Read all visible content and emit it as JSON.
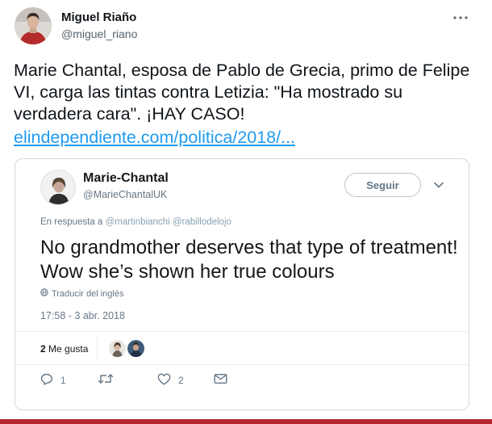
{
  "tweet": {
    "author": {
      "name": "Miguel Riaño",
      "handle": "@miguel_riano"
    },
    "text": "Marie Chantal, esposa de Pablo de Grecia, primo de Felipe VI, carga las tintas contra Letizia: \"Ha mostrado su verdadera cara\". ¡HAY CASO!",
    "link": "elindependiente.com/politica/2018/..."
  },
  "quoted": {
    "author": {
      "name": "Marie-Chantal",
      "handle": "@MarieChantalUK"
    },
    "follow_label": "Seguir",
    "reply_prefix": "En respuesta a",
    "reply_to": [
      "@martinbianchi",
      "@rabillodelojo"
    ],
    "text": "No grandmother deserves that type of treatment! Wow she’s shown her true colours",
    "translate_label": "Traducir del inglés",
    "timestamp": "17:58 - 3 abr. 2018",
    "likes": {
      "count": "2",
      "label": "Me gusta"
    },
    "actions": {
      "replies": "1",
      "retweets": "",
      "likes": "2"
    }
  },
  "icons": [
    "more-dots-icon",
    "chevron-down-icon",
    "globe-icon",
    "reply-icon",
    "retweet-icon",
    "heart-icon",
    "message-icon"
  ],
  "colors": {
    "link": "#1d9bf0",
    "muted": "#657786",
    "border": "#cfd9de",
    "accent_strip": "#b5262f"
  }
}
